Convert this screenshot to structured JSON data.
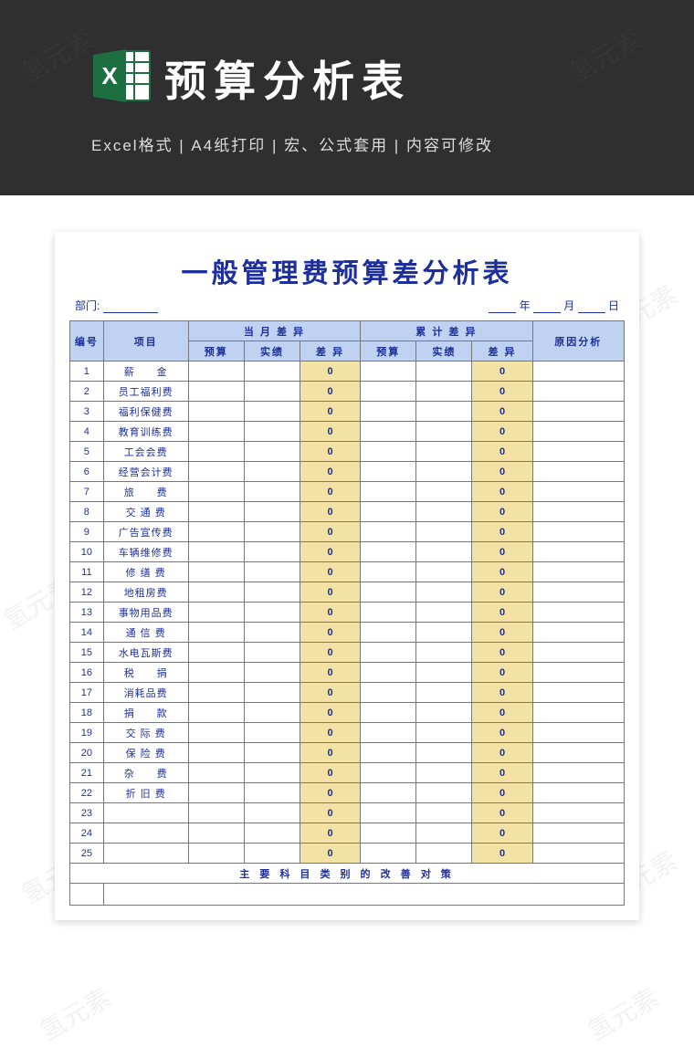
{
  "watermark_text": "氢元素",
  "banner": {
    "title": "预算分析表",
    "subtitle": "Excel格式 |  A4纸打印 |  宏、公式套用 | 内容可修改",
    "icon_name": "excel-icon"
  },
  "paper": {
    "title": "一般管理费预算差分析表",
    "meta": {
      "dept_label": "部门:",
      "year_label": "年",
      "month_label": "月",
      "day_label": "日"
    },
    "headers": {
      "col_id": "编号",
      "col_item": "项目",
      "group_month": "当 月 差 异",
      "group_total": "累 计 差 异",
      "col_reason": "原因分析",
      "sub_budget": "预算",
      "sub_actual": "实绩",
      "sub_diff": "差 异"
    },
    "rows": [
      {
        "id": "1",
        "item": "薪　　金",
        "m_budget": "",
        "m_actual": "",
        "m_diff": "0",
        "t_budget": "",
        "t_actual": "",
        "t_diff": "0",
        "reason": ""
      },
      {
        "id": "2",
        "item": "员工福利费",
        "m_budget": "",
        "m_actual": "",
        "m_diff": "0",
        "t_budget": "",
        "t_actual": "",
        "t_diff": "0",
        "reason": ""
      },
      {
        "id": "3",
        "item": "福利保健费",
        "m_budget": "",
        "m_actual": "",
        "m_diff": "0",
        "t_budget": "",
        "t_actual": "",
        "t_diff": "0",
        "reason": ""
      },
      {
        "id": "4",
        "item": "教育训练费",
        "m_budget": "",
        "m_actual": "",
        "m_diff": "0",
        "t_budget": "",
        "t_actual": "",
        "t_diff": "0",
        "reason": ""
      },
      {
        "id": "5",
        "item": "工会会费",
        "m_budget": "",
        "m_actual": "",
        "m_diff": "0",
        "t_budget": "",
        "t_actual": "",
        "t_diff": "0",
        "reason": ""
      },
      {
        "id": "6",
        "item": "经营会计费",
        "m_budget": "",
        "m_actual": "",
        "m_diff": "0",
        "t_budget": "",
        "t_actual": "",
        "t_diff": "0",
        "reason": ""
      },
      {
        "id": "7",
        "item": "旅　　费",
        "m_budget": "",
        "m_actual": "",
        "m_diff": "0",
        "t_budget": "",
        "t_actual": "",
        "t_diff": "0",
        "reason": ""
      },
      {
        "id": "8",
        "item": "交 通 费",
        "m_budget": "",
        "m_actual": "",
        "m_diff": "0",
        "t_budget": "",
        "t_actual": "",
        "t_diff": "0",
        "reason": ""
      },
      {
        "id": "9",
        "item": "广告宣传费",
        "m_budget": "",
        "m_actual": "",
        "m_diff": "0",
        "t_budget": "",
        "t_actual": "",
        "t_diff": "0",
        "reason": ""
      },
      {
        "id": "10",
        "item": "车辆维修费",
        "m_budget": "",
        "m_actual": "",
        "m_diff": "0",
        "t_budget": "",
        "t_actual": "",
        "t_diff": "0",
        "reason": ""
      },
      {
        "id": "11",
        "item": "修 缮 费",
        "m_budget": "",
        "m_actual": "",
        "m_diff": "0",
        "t_budget": "",
        "t_actual": "",
        "t_diff": "0",
        "reason": ""
      },
      {
        "id": "12",
        "item": "地租房费",
        "m_budget": "",
        "m_actual": "",
        "m_diff": "0",
        "t_budget": "",
        "t_actual": "",
        "t_diff": "0",
        "reason": ""
      },
      {
        "id": "13",
        "item": "事物用品费",
        "m_budget": "",
        "m_actual": "",
        "m_diff": "0",
        "t_budget": "",
        "t_actual": "",
        "t_diff": "0",
        "reason": ""
      },
      {
        "id": "14",
        "item": "通 信 费",
        "m_budget": "",
        "m_actual": "",
        "m_diff": "0",
        "t_budget": "",
        "t_actual": "",
        "t_diff": "0",
        "reason": ""
      },
      {
        "id": "15",
        "item": "水电瓦斯费",
        "m_budget": "",
        "m_actual": "",
        "m_diff": "0",
        "t_budget": "",
        "t_actual": "",
        "t_diff": "0",
        "reason": ""
      },
      {
        "id": "16",
        "item": "税　　捐",
        "m_budget": "",
        "m_actual": "",
        "m_diff": "0",
        "t_budget": "",
        "t_actual": "",
        "t_diff": "0",
        "reason": ""
      },
      {
        "id": "17",
        "item": "消耗品费",
        "m_budget": "",
        "m_actual": "",
        "m_diff": "0",
        "t_budget": "",
        "t_actual": "",
        "t_diff": "0",
        "reason": ""
      },
      {
        "id": "18",
        "item": "捐　　款",
        "m_budget": "",
        "m_actual": "",
        "m_diff": "0",
        "t_budget": "",
        "t_actual": "",
        "t_diff": "0",
        "reason": ""
      },
      {
        "id": "19",
        "item": "交 际 费",
        "m_budget": "",
        "m_actual": "",
        "m_diff": "0",
        "t_budget": "",
        "t_actual": "",
        "t_diff": "0",
        "reason": ""
      },
      {
        "id": "20",
        "item": "保 险 费",
        "m_budget": "",
        "m_actual": "",
        "m_diff": "0",
        "t_budget": "",
        "t_actual": "",
        "t_diff": "0",
        "reason": ""
      },
      {
        "id": "21",
        "item": "杂　　费",
        "m_budget": "",
        "m_actual": "",
        "m_diff": "0",
        "t_budget": "",
        "t_actual": "",
        "t_diff": "0",
        "reason": ""
      },
      {
        "id": "22",
        "item": "折 旧 费",
        "m_budget": "",
        "m_actual": "",
        "m_diff": "0",
        "t_budget": "",
        "t_actual": "",
        "t_diff": "0",
        "reason": ""
      },
      {
        "id": "23",
        "item": "",
        "m_budget": "",
        "m_actual": "",
        "m_diff": "0",
        "t_budget": "",
        "t_actual": "",
        "t_diff": "0",
        "reason": ""
      },
      {
        "id": "24",
        "item": "",
        "m_budget": "",
        "m_actual": "",
        "m_diff": "0",
        "t_budget": "",
        "t_actual": "",
        "t_diff": "0",
        "reason": ""
      },
      {
        "id": "25",
        "item": "",
        "m_budget": "",
        "m_actual": "",
        "m_diff": "0",
        "t_budget": "",
        "t_actual": "",
        "t_diff": "0",
        "reason": ""
      }
    ],
    "footer_label": "主 要 科 目 类 别 的 改 善 对 策"
  },
  "colors": {
    "header_bg": "#c0d2f2",
    "diff_bg": "#f3e2a5",
    "title_color": "#1d2f9c",
    "banner_bg": "#2f2f2f",
    "excel_green": "#1d6f42"
  }
}
